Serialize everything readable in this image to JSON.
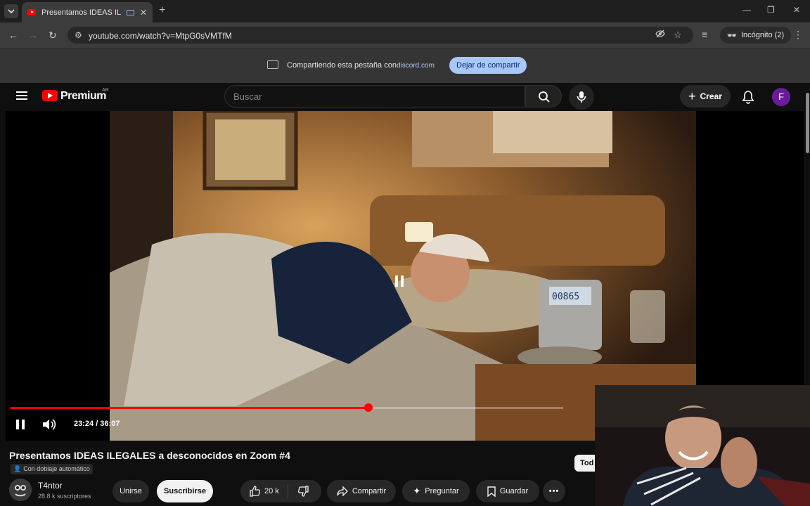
{
  "browser": {
    "tab_title": "Presentamos IDEAS ILEGAL",
    "new_tab_symbol": "+",
    "url": "youtube.com/watch?v=MtpG0sVMTfM",
    "incognito_label": "Incógnito (2)",
    "share_bar": {
      "text": "Compartiendo esta pestaña con",
      "domain": "discord.com",
      "stop_button": "Dejar de compartir"
    }
  },
  "youtube": {
    "logo_text": "Premium",
    "country_code": "AR",
    "search_placeholder": "Buscar",
    "create_label": "Crear",
    "avatar_letter": "F",
    "brand_color": "#ff0000"
  },
  "player": {
    "time_current": "23:24",
    "time_total": "36:07",
    "time_display": "23:24 / 36:07",
    "progress_fraction": 0.648,
    "buffered_fraction": 1.0
  },
  "video": {
    "title": "Presentamos IDEAS ILEGALES a desconocidos en Zoom #4",
    "dub_badge": "Con doblaje automático",
    "channel_name": "T4ntor",
    "subscribers": "28.8 k suscriptores",
    "join_label": "Unirse",
    "subscribe_label": "Suscribirse",
    "likes": "20 k",
    "share_label": "Compartir",
    "ask_label": "Preguntar",
    "save_label": "Guardar",
    "filter_chip": "Tod",
    "counter_display": "00865"
  }
}
